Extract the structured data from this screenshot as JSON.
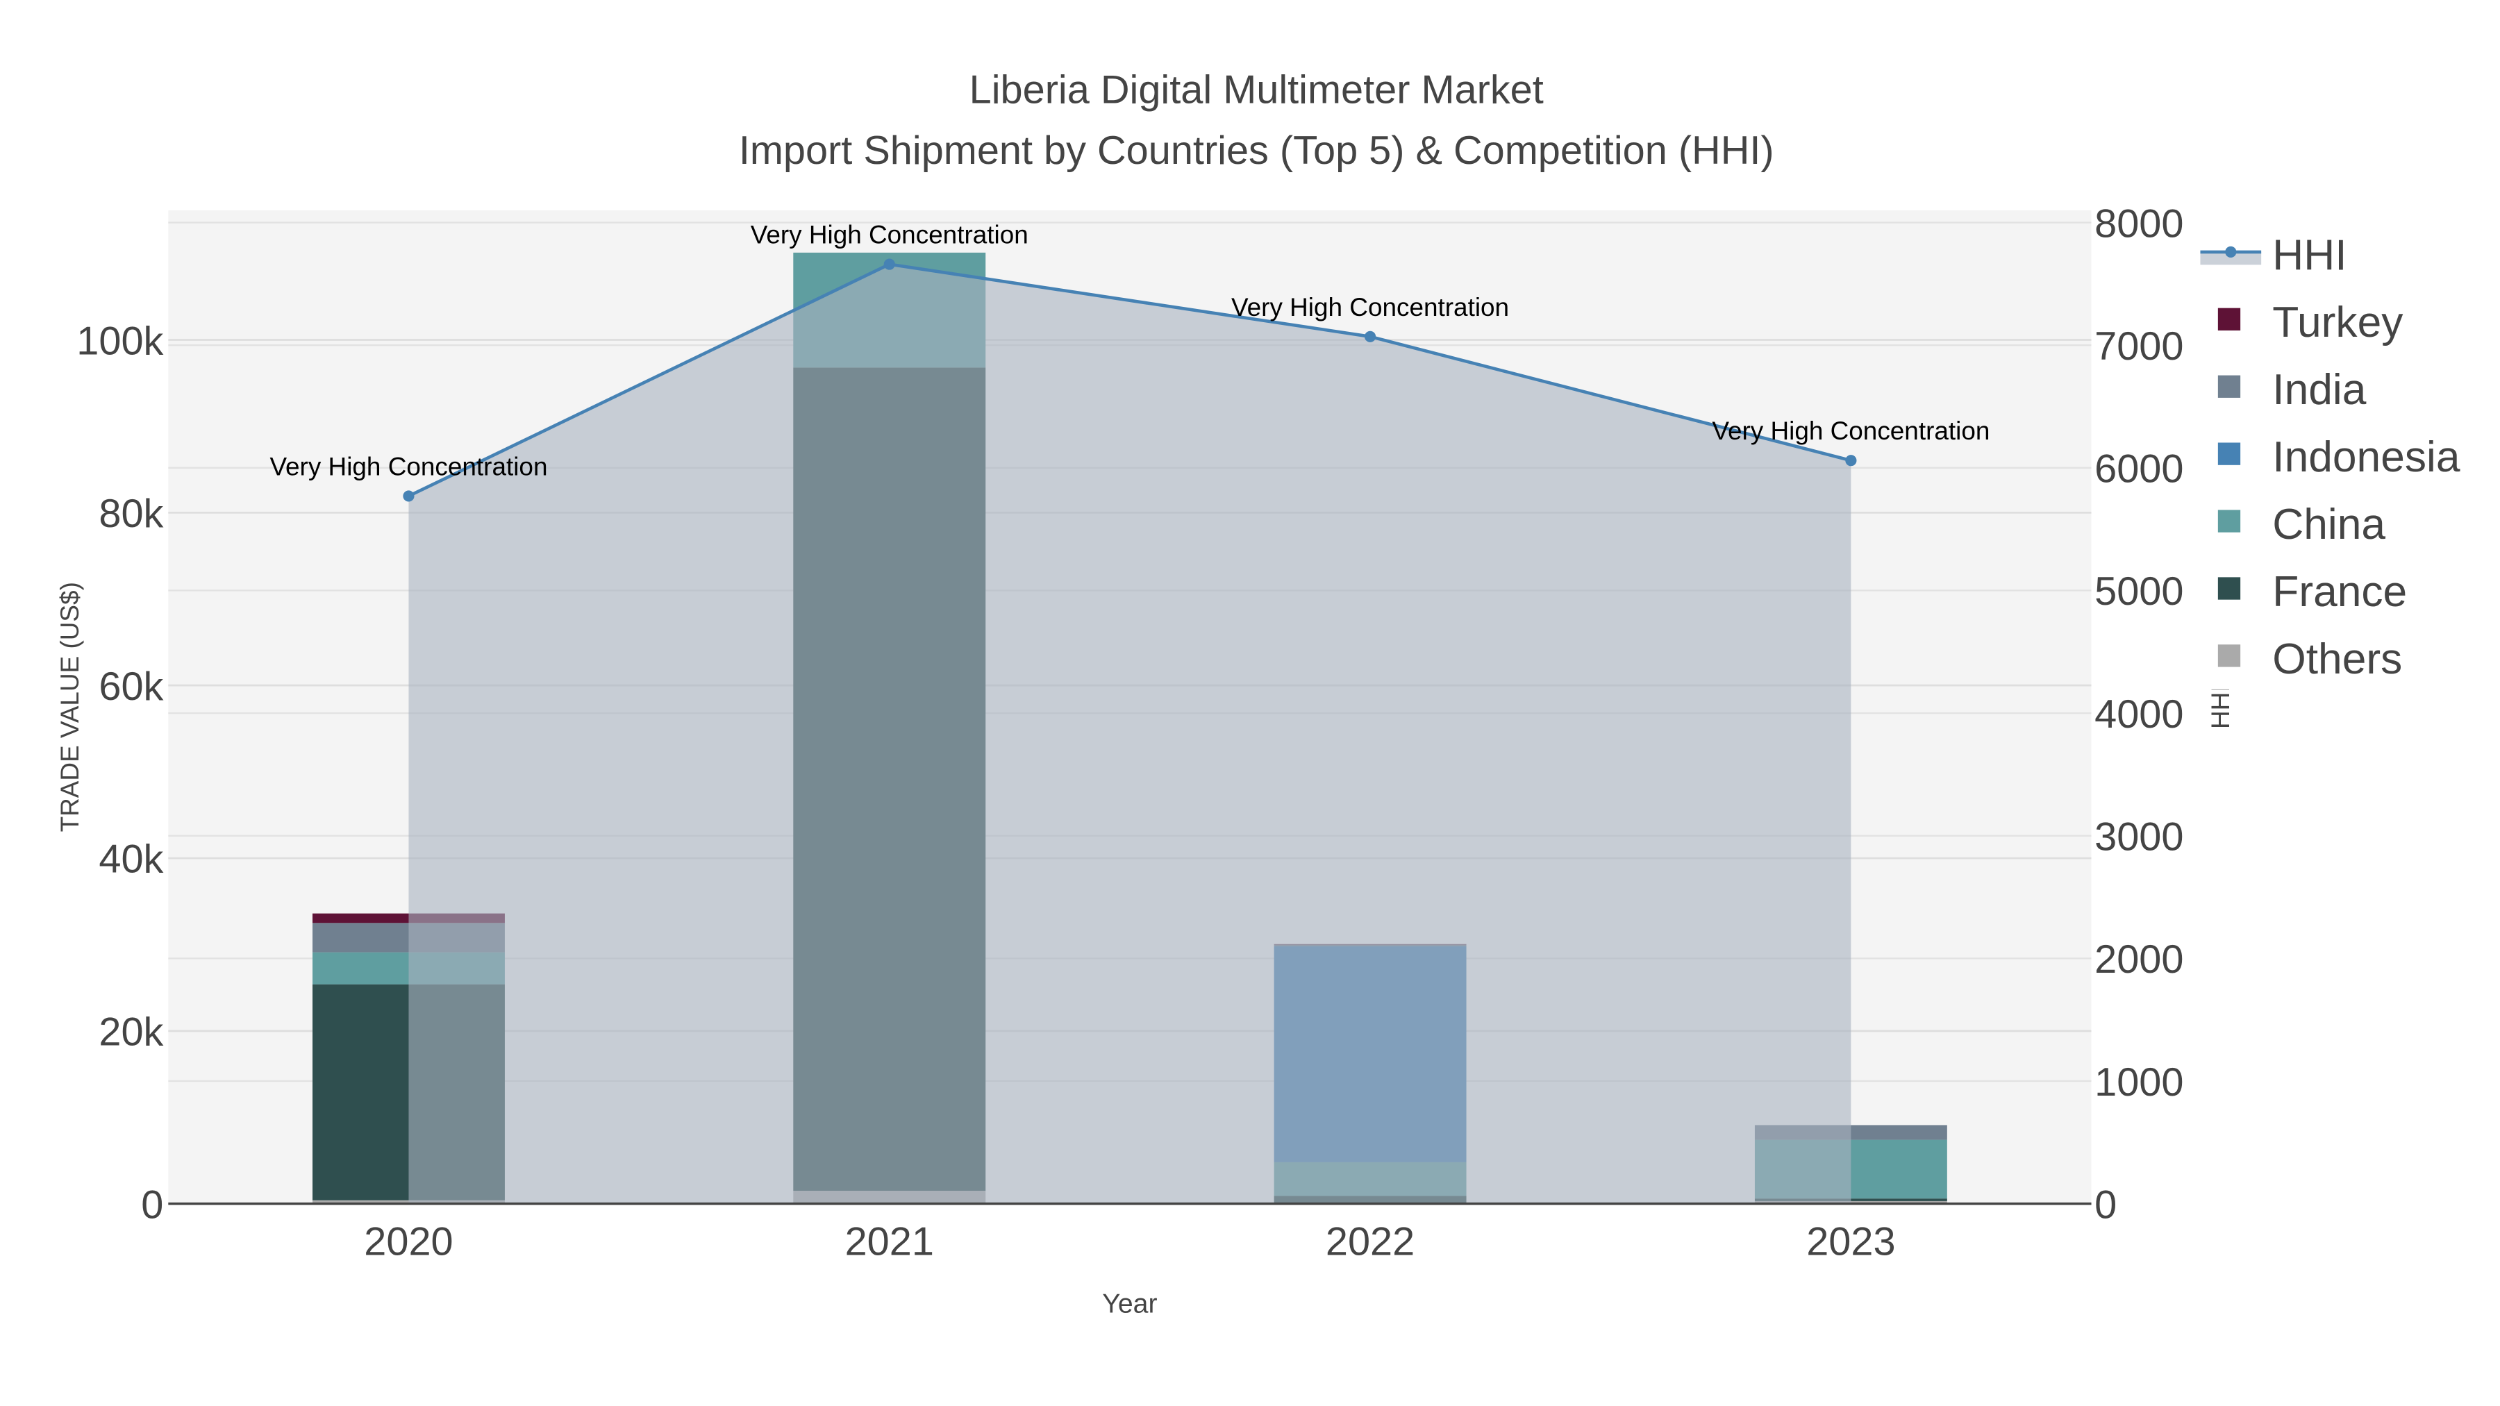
{
  "chart_data": {
    "type": "bar",
    "title": "Liberia Digital Multimeter Market",
    "subtitle": "Import Shipment by Countries (Top 5) & Competition (HHI)",
    "xlabel": "Year",
    "ylabel": "TRADE VALUE (US$)",
    "y2label": "HHI",
    "categories": [
      "2020",
      "2021",
      "2022",
      "2023"
    ],
    "ylim": [
      0,
      115000
    ],
    "y2lim": [
      0,
      8100
    ],
    "yticks": [
      0,
      20000,
      40000,
      60000,
      80000,
      100000
    ],
    "ytick_labels": [
      "0",
      "20k",
      "40k",
      "60k",
      "80k",
      "100k"
    ],
    "y2ticks": [
      0,
      1000,
      2000,
      3000,
      4000,
      5000,
      6000,
      7000,
      8000
    ],
    "y2tick_labels": [
      "0",
      "1000",
      "2000",
      "3000",
      "4000",
      "5000",
      "6000",
      "7000",
      "8000"
    ],
    "stacked": true,
    "legend_position": "right",
    "series": [
      {
        "name": "Others",
        "color": "#aaaaaa",
        "values": [
          400,
          1500,
          100,
          300
        ]
      },
      {
        "name": "France",
        "color": "#2f4f4f",
        "values": [
          25000,
          95300,
          800,
          300
        ]
      },
      {
        "name": "China",
        "color": "#5f9ea0",
        "values": [
          3700,
          13300,
          3900,
          6800
        ]
      },
      {
        "name": "Indonesia",
        "color": "#4682b4",
        "values": [
          0,
          0,
          25000,
          0
        ]
      },
      {
        "name": "India",
        "color": "#708090",
        "values": [
          3400,
          0,
          200,
          1700
        ]
      },
      {
        "name": "Turkey",
        "color": "#5e1236",
        "values": [
          1100,
          0,
          50,
          0
        ]
      }
    ],
    "hhi": {
      "name": "HHI",
      "color": "#4682b4",
      "values": [
        5770,
        7660,
        7070,
        6060
      ],
      "labels": [
        "Very High Concentration",
        "Very High Concentration",
        "Very High Concentration",
        "Very High Concentration"
      ]
    },
    "legend_order": [
      "HHI",
      "Turkey",
      "India",
      "Indonesia",
      "China",
      "France",
      "Others"
    ]
  }
}
